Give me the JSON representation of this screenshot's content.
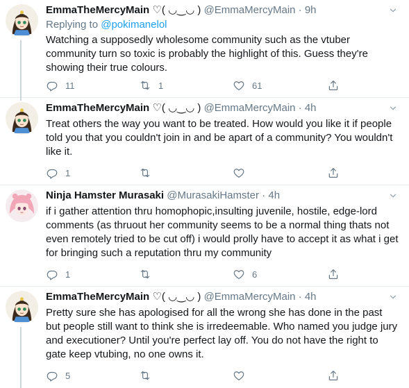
{
  "tweets": [
    {
      "name": "EmmaTheMercyMain",
      "name_suffix": "♡( ◡‿◡ )",
      "handle": "@EmmaMercyMain",
      "time": "9h",
      "reply_label": "Replying to",
      "reply_mention": "@pokimanelol",
      "text": "Watching a supposedly wholesome community such as the vtuber community turn so toxic is probably the highlight of this. Guess they're showing their true colours.",
      "replies": "11",
      "retweets": "1",
      "likes": "61"
    },
    {
      "name": "EmmaTheMercyMain",
      "name_suffix": "♡( ◡‿◡ )",
      "handle": "@EmmaMercyMain",
      "time": "4h",
      "text": "Treat others the way you want to be treated. How would you like it if people told you that you couldn't join in and be apart of a community? You wouldn't like it.",
      "replies": "1",
      "retweets": "",
      "likes": ""
    },
    {
      "name": "Ninja Hamster Murasaki",
      "name_suffix": "",
      "handle": "@MurasakiHamster",
      "time": "4h",
      "text": "if i gather attention thru homophopic,insulting juvenile, hostile, edge-lord comments (as thruout her community seems to be a normal thing thats not even remotely tried to be cut off) i would prolly have to accept it as what i get for bringing such a reputation thru my community",
      "replies": "1",
      "retweets": "",
      "likes": "6"
    },
    {
      "name": "EmmaTheMercyMain",
      "name_suffix": "♡( ◡‿◡ )",
      "handle": "@EmmaMercyMain",
      "time": "4h",
      "text": "Pretty sure she has apologised for all the wrong she has done in the past but people still want to think she is irredeemable. Who named you judge jury and executioner? Until you're perfect lay off. You do not have the right to gate keep vtubing, no one owns it.",
      "replies": "5",
      "retweets": "",
      "likes": ""
    }
  ],
  "dot": "·",
  "colors": {
    "accent": "#1da1f2",
    "secondary_text": "#657786",
    "divider": "#e6ecf0"
  }
}
